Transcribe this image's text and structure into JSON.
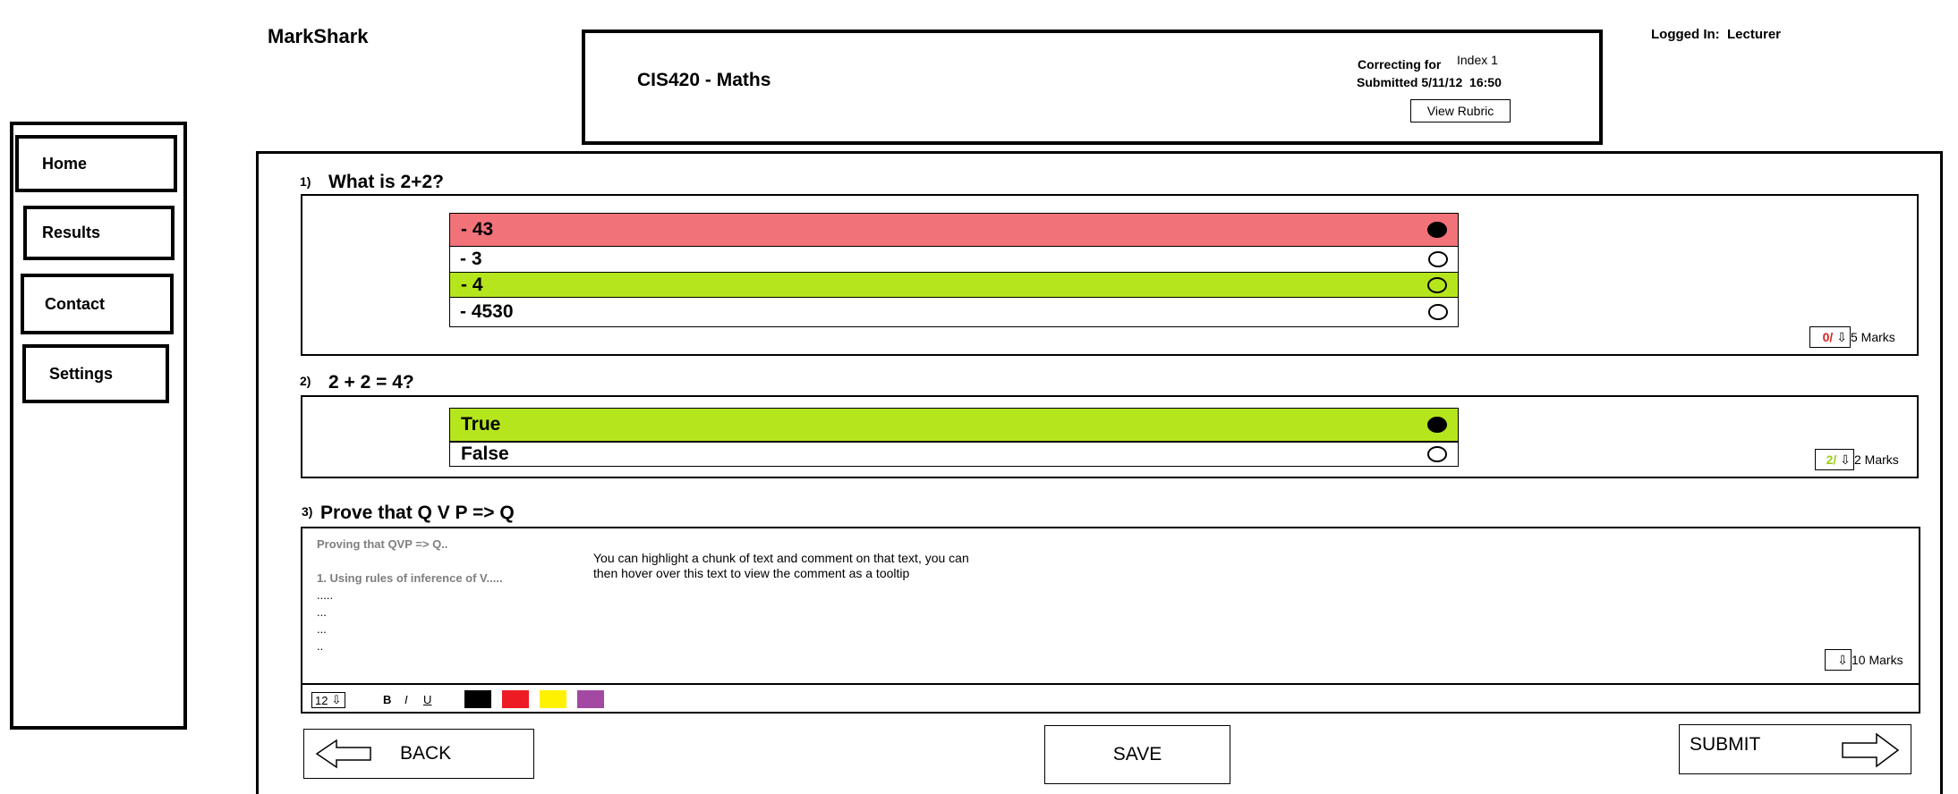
{
  "app": {
    "title": "MarkShark"
  },
  "user": {
    "logged_in": "Logged In:  Lecturer"
  },
  "header": {
    "course": "CIS420 - Maths",
    "correcting_label": "Correcting for",
    "correcting_value": "Index 1",
    "submitted": "Submitted 5/11/12  16:50",
    "view_rubric": "View Rubric"
  },
  "sidebar": {
    "items": [
      {
        "label": "Home"
      },
      {
        "label": "Results"
      },
      {
        "label": "Contact"
      },
      {
        "label": "Settings"
      }
    ]
  },
  "questions": [
    {
      "number": "1)",
      "text": "What is 2+2?",
      "options": [
        {
          "label": "- 43",
          "state": "selected-wrong",
          "color": "#f2727a"
        },
        {
          "label": "- 3",
          "state": "none"
        },
        {
          "label": "- 4",
          "state": "correct",
          "color": "#b5e61d"
        },
        {
          "label": "- 4530",
          "state": "none"
        }
      ],
      "score": "0/",
      "score_color": "#e02020",
      "total": "5 Marks"
    },
    {
      "number": "2)",
      "text": "2 + 2 = 4?",
      "options": [
        {
          "label": "True",
          "state": "selected-correct",
          "color": "#b5e61d"
        },
        {
          "label": "False",
          "state": "none"
        }
      ],
      "score": "2/",
      "score_color": "#9ccc1a",
      "total": "2 Marks"
    },
    {
      "number": "3)",
      "text": "Prove that Q V P => Q",
      "answer_lines": [
        "Proving that QVP => Q..",
        "",
        "1. Using rules of inference of V.....",
        ".....",
        "...",
        "...",
        ".."
      ],
      "hint": "You can highlight a chunk of text and comment on that text, you can then hover over this text to view the comment as a tooltip",
      "score": "",
      "total": "10 Marks",
      "toolbar": {
        "font_size": "12",
        "bold": "B",
        "italic": "I",
        "underline": "U",
        "colors": [
          "#000000",
          "#ed1c24",
          "#fff200",
          "#a349a4"
        ]
      }
    }
  ],
  "footer": {
    "back": "BACK",
    "save": "SAVE",
    "submit": "SUBMIT"
  },
  "icons": {
    "stepper": "down-arrow-icon",
    "back": "left-arrow-icon",
    "submit": "right-arrow-icon"
  }
}
